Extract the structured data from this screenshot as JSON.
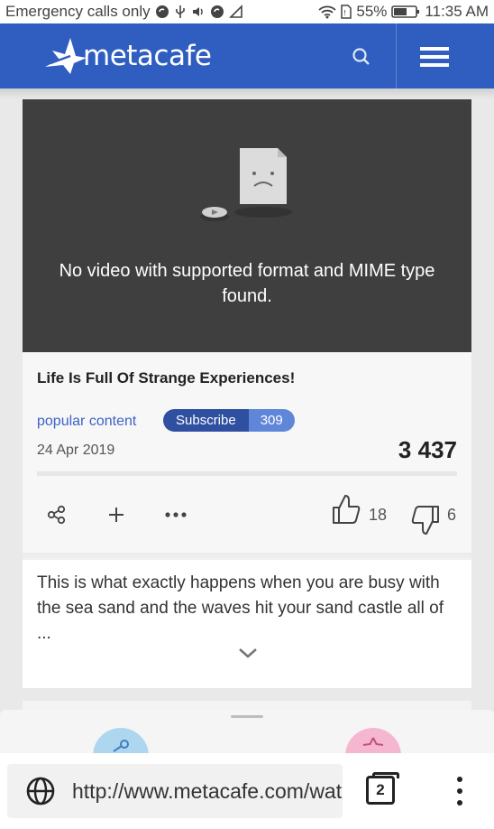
{
  "status_bar": {
    "carrier": "Emergency calls only",
    "battery": "55%",
    "time": "11:35 AM",
    "icons": [
      "sync-icon",
      "usb-icon",
      "volume-icon",
      "sync-icon",
      "signal-icon",
      "wifi-icon",
      "sim-icon",
      "battery-icon"
    ]
  },
  "header": {
    "logo_text": "metacafe",
    "search_icon": "search-icon",
    "menu_icon": "hamburger-menu-icon",
    "bg_color": "#2f5ec0"
  },
  "video": {
    "error_message": "No video with supported format and MIME type found.",
    "bg_color": "#3f3f3f"
  },
  "post": {
    "title": "Life Is Full Of Strange Experiences!",
    "channel": "popular content",
    "subscribe_label": "Subscribe",
    "subscriber_count": "309",
    "date": "24 Apr 2019",
    "views": "3 437",
    "likes": "18",
    "dislikes": "6"
  },
  "description": {
    "text": "This is what exactly happens when you are busy with the sea sand and the waves hit your sand castle all of ..."
  },
  "browser": {
    "url": "http://www.metacafe.com/watch",
    "tab_count": "2"
  }
}
